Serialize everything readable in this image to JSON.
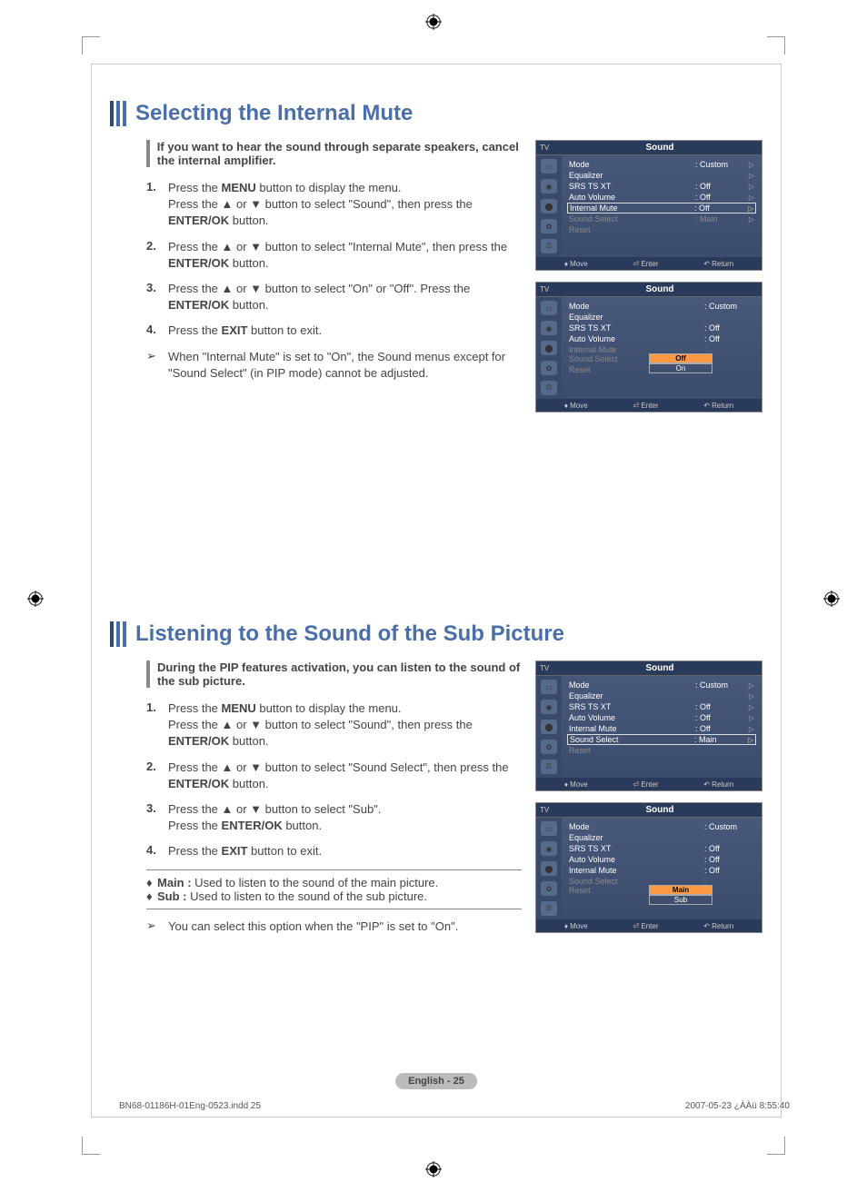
{
  "section1": {
    "title": "Selecting the Internal Mute",
    "intro": "If you want to hear the sound through separate speakers, cancel the internal amplifier.",
    "steps": [
      "Press the MENU button to display the menu. Press the ▲ or ▼ button to select \"Sound\", then press the ENTER/OK button.",
      "Press the ▲ or ▼ button to select \"Internal Mute\", then press the ENTER/OK button.",
      "Press the ▲ or ▼ button to select \"On\" or \"Off\". Press the ENTER/OK button.",
      "Press the EXIT button to exit."
    ],
    "note": "When \"Internal Mute\" is set to \"On\", the Sound menus except for \"Sound Select\" (in PIP mode) cannot be adjusted."
  },
  "section2": {
    "title": "Listening to the Sound of the Sub Picture",
    "intro": "During the PIP features activation, you can listen to the sound of the sub picture.",
    "steps": [
      "Press the MENU button to display the menu. Press the ▲ or ▼ button to select \"Sound\", then press the ENTER/OK button.",
      "Press the ▲ or ▼ button to select \"Sound Select\", then press the ENTER/OK button.",
      "Press the ▲ or ▼ button to select \"Sub\". Press the ENTER/OK button.",
      "Press the EXIT button to exit."
    ],
    "defs": {
      "main": "Main :  Used to listen to the sound of the main picture.",
      "sub": "Sub :  Used to listen to the sound of the sub picture."
    },
    "note": "You can select this option when the \"PIP\" is set to \"On\"."
  },
  "osd": {
    "tv": "TV",
    "title": "Sound",
    "rows": {
      "mode": {
        "label": "Mode",
        "value": ": Custom"
      },
      "equalizer": {
        "label": "Equalizer",
        "value": ""
      },
      "srs": {
        "label": "SRS TS XT",
        "value": ": Off"
      },
      "auto_volume": {
        "label": "Auto Volume",
        "value": ": Off"
      },
      "internal_mute": {
        "label": "Internal Mute",
        "value": ": Off"
      },
      "sound_select": {
        "label": "Sound Select",
        "value": ": Main"
      },
      "reset": {
        "label": "Reset",
        "value": ""
      }
    },
    "options_mute": {
      "off": "Off",
      "on": "On"
    },
    "options_sub": {
      "main": "Main",
      "sub": "Sub"
    },
    "footer": {
      "move": "Move",
      "enter": "Enter",
      "return": "Return"
    }
  },
  "page_number": "English - 25",
  "footer": {
    "left": "BN68-01186H-01Eng-0523.indd   25",
    "right": "2007-05-23   ¿ÀÀü 8:55:40"
  }
}
